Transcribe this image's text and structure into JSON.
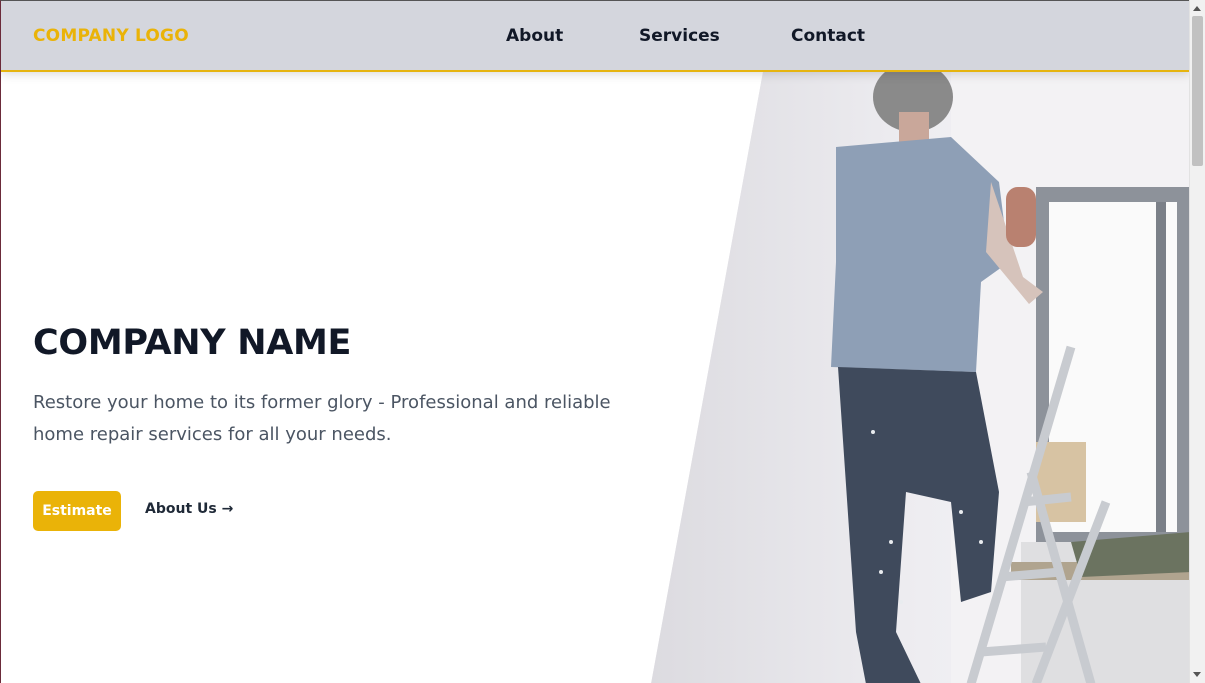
{
  "header": {
    "logo": "COMPANY LOGO",
    "nav": [
      "About",
      "Services",
      "Contact"
    ]
  },
  "hero": {
    "title": "COMPANY NAME",
    "description": "Restore your home to its former glory - Professional and reliable home repair services for all your needs.",
    "primary_button": "Estimate",
    "secondary_link": "About Us →"
  },
  "image": {
    "alt": "Man on a ladder painting a wall"
  },
  "colors": {
    "accent": "#eab308",
    "header_bg": "#d4d6dd",
    "heading": "#111827",
    "body_text": "#4b5563"
  }
}
